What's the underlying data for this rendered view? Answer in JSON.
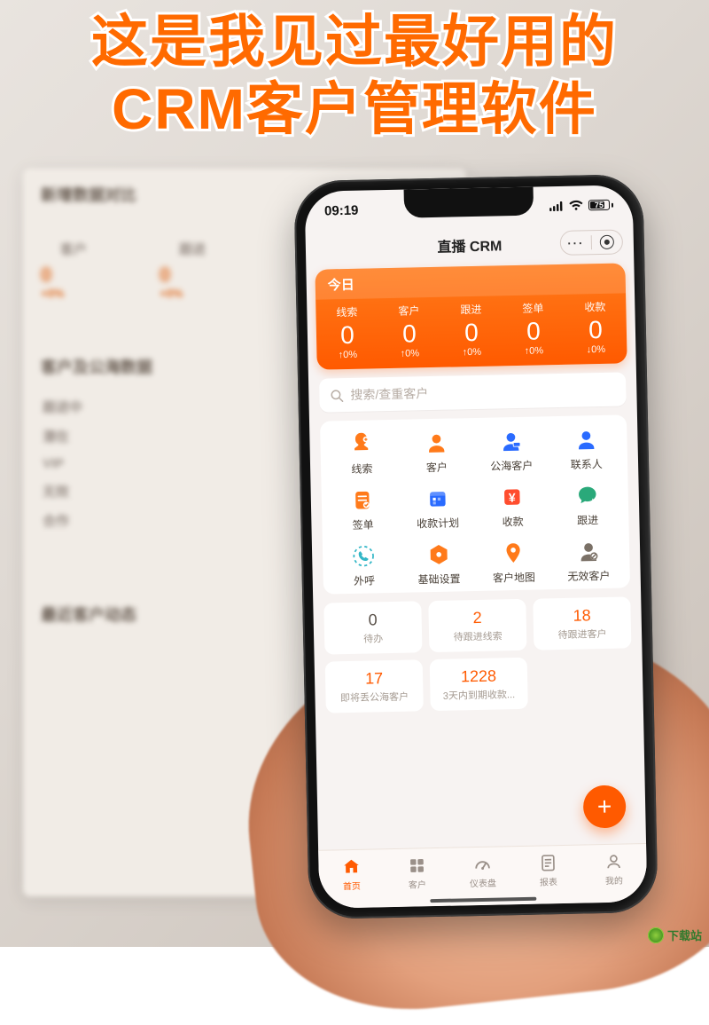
{
  "overlay": {
    "line1": "这是我见过最好用的",
    "line2": "CRM客户管理软件"
  },
  "bg_dashboard": {
    "section1_title": "新增数据对比",
    "cols": [
      "客户",
      "跟进"
    ],
    "vals": [
      "0",
      "0"
    ],
    "pcts": [
      "+0%",
      "+0%"
    ],
    "section2_title": "客户及公海数据",
    "rows": [
      "跟进中",
      "潜在",
      "VIP",
      "无效",
      "合作"
    ],
    "section3_title": "最近客户动态"
  },
  "statusbar": {
    "time": "09:19",
    "battery": "75"
  },
  "navbar": {
    "title": "直播 CRM",
    "more": "···"
  },
  "today": {
    "header": "今日",
    "stats": [
      {
        "label": "线索",
        "value": "0",
        "delta": "↑0%"
      },
      {
        "label": "客户",
        "value": "0",
        "delta": "↑0%"
      },
      {
        "label": "跟进",
        "value": "0",
        "delta": "↑0%"
      },
      {
        "label": "签单",
        "value": "0",
        "delta": "↑0%"
      },
      {
        "label": "收款",
        "value": "0",
        "delta": "↓0%"
      }
    ]
  },
  "search": {
    "placeholder": "搜索/查重客户"
  },
  "grid": [
    {
      "icon": "leads-icon",
      "label": "线索",
      "color": "#ff7a1a"
    },
    {
      "icon": "customer-icon",
      "label": "客户",
      "color": "#ff7a1a"
    },
    {
      "icon": "sea-customer-icon",
      "label": "公海客户",
      "color": "#2a6bff"
    },
    {
      "icon": "contact-icon",
      "label": "联系人",
      "color": "#2a6bff"
    },
    {
      "icon": "sign-icon",
      "label": "签单",
      "color": "#ff7a1a"
    },
    {
      "icon": "plan-icon",
      "label": "收款计划",
      "color": "#2a6bff"
    },
    {
      "icon": "payment-icon",
      "label": "收款",
      "color": "#ff4d2e"
    },
    {
      "icon": "follow-icon",
      "label": "跟进",
      "color": "#2aa97a"
    },
    {
      "icon": "call-icon",
      "label": "外呼",
      "color": "#33b7c7"
    },
    {
      "icon": "settings-icon",
      "label": "基础设置",
      "color": "#ff7a1a"
    },
    {
      "icon": "map-icon",
      "label": "客户地图",
      "color": "#ff7a1a"
    },
    {
      "icon": "invalid-icon",
      "label": "无效客户",
      "color": "#7a7066"
    }
  ],
  "tasks": [
    {
      "num": "0",
      "label": "待办",
      "accent": false
    },
    {
      "num": "2",
      "label": "待跟进线索",
      "accent": true
    },
    {
      "num": "18",
      "label": "待跟进客户",
      "accent": true
    },
    {
      "num": "17",
      "label": "即将丢公海客户",
      "accent": true
    },
    {
      "num": "1228",
      "label": "3天内到期收款...",
      "accent": true
    }
  ],
  "fab": {
    "label": "+"
  },
  "tabbar": [
    {
      "icon": "home-icon",
      "label": "首页",
      "active": true
    },
    {
      "icon": "customer-tab-icon",
      "label": "客户",
      "active": false
    },
    {
      "icon": "dashboard-icon",
      "label": "仪表盘",
      "active": false
    },
    {
      "icon": "report-icon",
      "label": "报表",
      "active": false
    },
    {
      "icon": "me-icon",
      "label": "我的",
      "active": false
    }
  ],
  "watermark": {
    "text": "下载站"
  }
}
